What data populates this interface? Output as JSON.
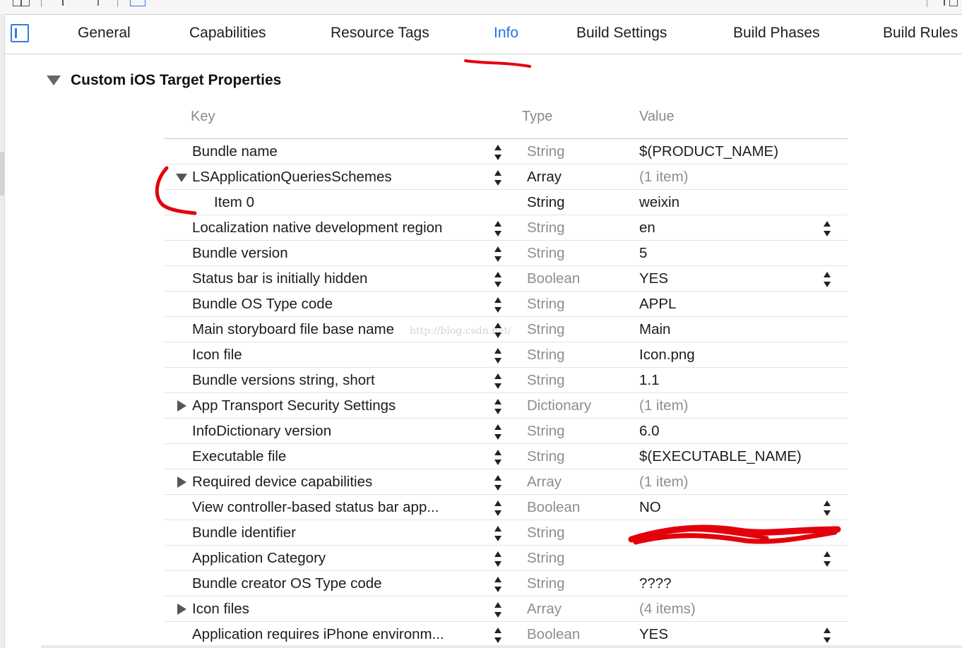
{
  "tabs": [
    {
      "label": "General",
      "active": false
    },
    {
      "label": "Capabilities",
      "active": false
    },
    {
      "label": "Resource Tags",
      "active": false
    },
    {
      "label": "Info",
      "active": true
    },
    {
      "label": "Build Settings",
      "active": false
    },
    {
      "label": "Build Phases",
      "active": false
    },
    {
      "label": "Build Rules",
      "active": false
    }
  ],
  "section": {
    "title": "Custom iOS Target Properties",
    "expanded": true
  },
  "columns": {
    "key": "Key",
    "type": "Type",
    "value": "Value"
  },
  "rows": [
    {
      "key": "Bundle name",
      "type": "String",
      "value": "$(PRODUCT_NAME)"
    },
    {
      "key": "LSApplicationQueriesSchemes",
      "type": "Array",
      "value": "(1 item)"
    },
    {
      "key": "Item 0",
      "type": "String",
      "value": "weixin"
    },
    {
      "key": "Localization native development region",
      "type": "String",
      "value": "en"
    },
    {
      "key": "Bundle version",
      "type": "String",
      "value": "5"
    },
    {
      "key": "Status bar is initially hidden",
      "type": "Boolean",
      "value": "YES"
    },
    {
      "key": "Bundle OS Type code",
      "type": "String",
      "value": "APPL"
    },
    {
      "key": "Main storyboard file base name",
      "type": "String",
      "value": "Main"
    },
    {
      "key": "Icon file",
      "type": "String",
      "value": "Icon.png"
    },
    {
      "key": "Bundle versions string, short",
      "type": "String",
      "value": "1.1"
    },
    {
      "key": "App Transport Security Settings",
      "type": "Dictionary",
      "value": "(1 item)"
    },
    {
      "key": "InfoDictionary version",
      "type": "String",
      "value": "6.0"
    },
    {
      "key": "Executable file",
      "type": "String",
      "value": "$(EXECUTABLE_NAME)"
    },
    {
      "key": "Required device capabilities",
      "type": "Array",
      "value": "(1 item)"
    },
    {
      "key": "View controller-based status bar app...",
      "type": "Boolean",
      "value": "NO"
    },
    {
      "key": "Bundle identifier",
      "type": "String",
      "value": ""
    },
    {
      "key": "Application Category",
      "type": "String",
      "value": ""
    },
    {
      "key": "Bundle creator OS Type code",
      "type": "String",
      "value": "????"
    },
    {
      "key": "Icon files",
      "type": "Array",
      "value": "(4 items)"
    },
    {
      "key": "Application requires iPhone environm...",
      "type": "Boolean",
      "value": "YES"
    }
  ],
  "watermark": "http://blog.csdn.net/",
  "colors": {
    "accent": "#1f73e8",
    "annotation": "#e3000b",
    "muted": "#8e8e8e"
  }
}
